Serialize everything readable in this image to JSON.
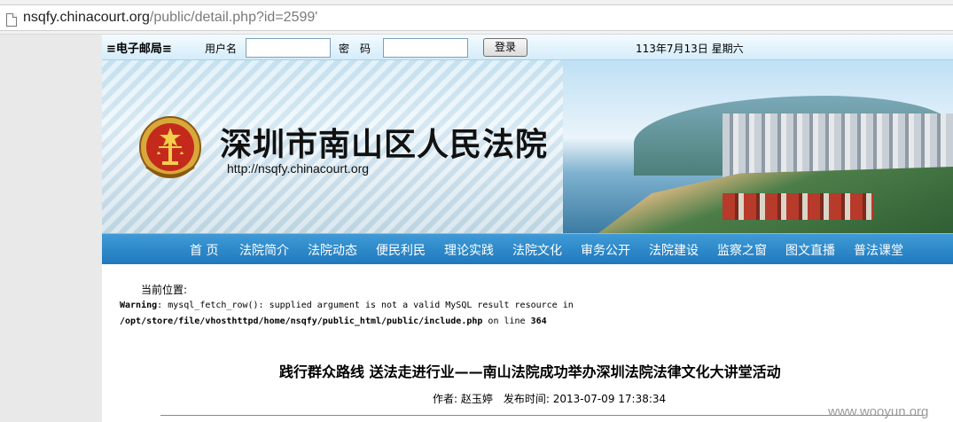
{
  "browser": {
    "url_host": "nsqfy.chinacourt.org",
    "url_path": "/public/detail.php?id=2599'"
  },
  "login": {
    "mail_title": "≡电子邮局≡",
    "user_label": "用户名",
    "password_label": "密　码",
    "login_button": "登录",
    "date": "113年7月13日 星期六",
    "user_value": "",
    "password_value": ""
  },
  "banner": {
    "court_name": "深圳市南山区人民法院",
    "court_url": "http://nsqfy.chinacourt.org"
  },
  "nav": {
    "items": [
      "首 页",
      "法院简介",
      "法院动态",
      "便民利民",
      "理论实践",
      "法院文化",
      "审务公开",
      "法院建设",
      "监察之窗",
      "图文直播",
      "普法课堂"
    ]
  },
  "content": {
    "breadcrumb": "当前位置:",
    "warning_label": "Warning",
    "warning_text": ": mysql_fetch_row(): supplied argument is not a valid MySQL result resource in",
    "warning_path": "/opt/store/file/vhosthttpd/home/nsqfy/public_html/public/include.php",
    "warning_on_line": " on line ",
    "warning_line": "364",
    "article_title": "践行群众路线 送法走进行业——南山法院成功举办深圳法院法律文化大讲堂活动",
    "meta": "作者: 赵玉婷　发布时间: 2013-07-09 17:38:34"
  },
  "watermark": "www.wooyun.org",
  "colors": {
    "nav_bg": "#2a86c9",
    "login_strip": "#d4ecfa"
  }
}
